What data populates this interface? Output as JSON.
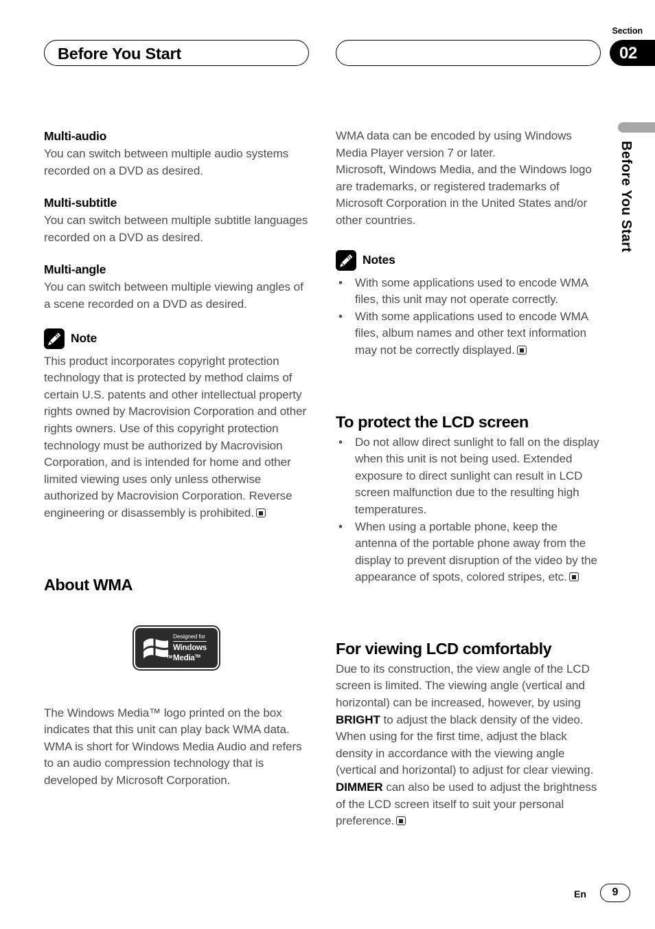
{
  "header": {
    "title": "Before You Start",
    "section_label": "Section",
    "section_number": "02",
    "side_tab": "Before You Start"
  },
  "left_column": {
    "multi_audio": {
      "heading": "Multi-audio",
      "body": "You can switch between multiple audio systems recorded on a DVD as desired."
    },
    "multi_subtitle": {
      "heading": "Multi-subtitle",
      "body": "You can switch between multiple subtitle languages recorded on a DVD as desired."
    },
    "multi_angle": {
      "heading": "Multi-angle",
      "body": "You can switch between multiple viewing angles of a scene recorded on a DVD as desired."
    },
    "note": {
      "label": "Note",
      "icon": "pencil-note-icon",
      "body": "This product incorporates copyright protection technology that is protected by method claims of certain U.S. patents and other intellectual property rights owned by Macrovision Corporation and other rights owners. Use of this copyright protection technology must be authorized by Macrovision Corporation, and is intended for home and other limited viewing uses only unless otherwise authorized by Macrovision Corporation. Reverse engineering or disassembly is prohibited."
    },
    "about_wma": {
      "heading": "About WMA",
      "logo": {
        "designed_for": "Designed for",
        "brand_line1": "Windows",
        "brand_line2": "Media",
        "trademark": "TM"
      },
      "paragraph1": "The Windows Media™ logo printed on the box indicates that this unit can play back WMA data.",
      "paragraph2": "WMA is short for Windows Media Audio and refers to an audio compression technology that is developed by Microsoft Corporation."
    }
  },
  "right_column": {
    "wma_intro": {
      "paragraph1": "WMA data can be encoded by using Windows Media Player version 7 or later.",
      "paragraph2": "Microsoft, Windows Media, and the Windows logo are trademarks, or registered trademarks of Microsoft Corporation in the United States and/or other countries."
    },
    "notes": {
      "label": "Notes",
      "icon": "pencil-note-icon",
      "items": [
        "With some applications used to encode WMA files, this unit may not operate correctly.",
        "With some applications used to encode WMA files, album names and other text information may not be correctly displayed."
      ]
    },
    "protect_lcd": {
      "heading": "To protect the LCD screen",
      "items": [
        "Do not allow direct sunlight to fall on the display when this unit is not being used. Extended exposure to direct sunlight can result in LCD screen malfunction due to the resulting high temperatures.",
        "When using a portable phone, keep the antenna of the portable phone away from the display to prevent disruption of the video by the appearance of spots, colored stripes, etc."
      ]
    },
    "viewing_comfort": {
      "heading": "For viewing LCD comfortably",
      "text_part1": "Due to its construction, the view angle of the LCD screen is limited. The viewing angle (vertical and horizontal) can be increased, however, by using ",
      "bold1": "BRIGHT",
      "text_part2": " to adjust the black density of the video. When using for the first time, adjust the black density in accordance with the viewing angle (vertical and horizontal) to adjust for clear viewing. ",
      "bold2": "DIMMER",
      "text_part3": " can also be used to adjust the brightness of the LCD screen itself to suit your personal preference."
    }
  },
  "footer": {
    "language": "En",
    "page_number": "9"
  }
}
